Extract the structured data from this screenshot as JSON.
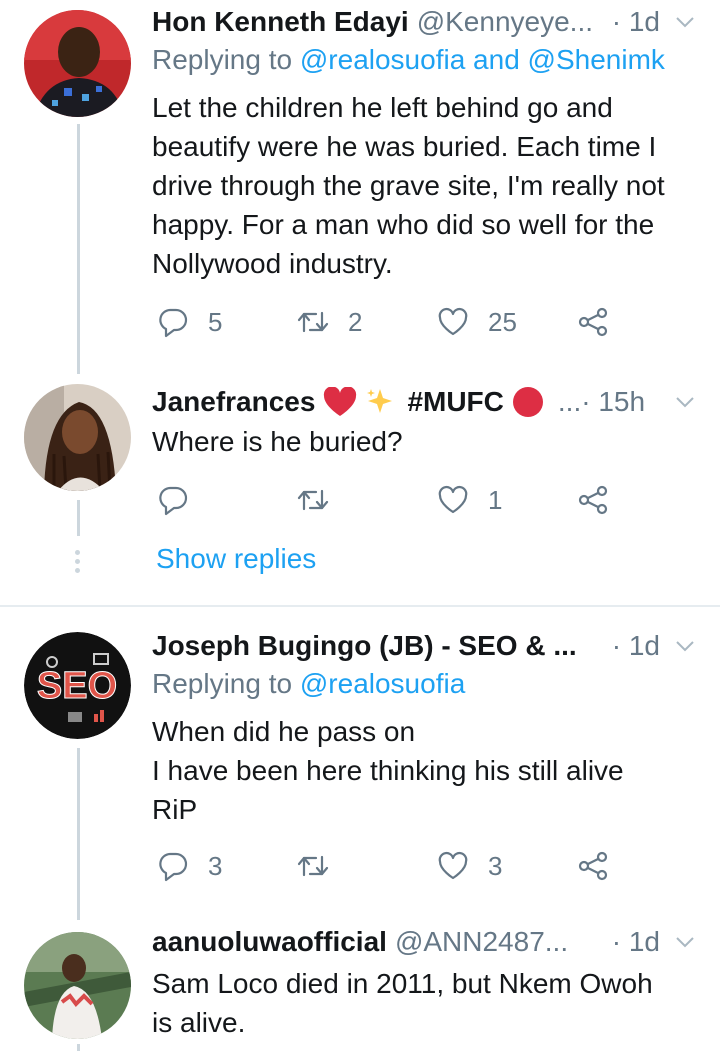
{
  "tweets": [
    {
      "name": "Hon Kenneth Edayi",
      "handle": "@Kennyeye...",
      "time": "· 1d",
      "replying_prefix": "Replying to",
      "replying_mentions": "@realosuofia and @Shenimk",
      "text_lines": [
        "Let the children he left behind go and",
        "beautify were he was buried. Each time I",
        "drive through the grave site, I'm really not",
        "happy. For a man who did so well for the",
        "Nollywood industry."
      ],
      "replies": "5",
      "retweets": "2",
      "likes": "25"
    },
    {
      "name": "Janefrances",
      "name_suffix": "#MUFC",
      "handle": "...",
      "time": "· 15h",
      "text_lines": [
        "Where is he buried?"
      ],
      "replies": "",
      "retweets": "",
      "likes": "1"
    },
    {
      "name": "Joseph Bugingo (JB) - SEO & ...",
      "handle": "",
      "time": "· 1d",
      "replying_prefix": "Replying to",
      "replying_mentions": "@realosuofia",
      "text_lines": [
        "When did he pass on",
        "I have been here thinking his still alive",
        "RiP"
      ],
      "replies": "3",
      "retweets": "",
      "likes": "3"
    },
    {
      "name": "aanuoluwaofficial",
      "handle": "@ANN2487...",
      "time": "· 1d",
      "text_lines": [
        "Sam Loco died in 2011, but Nkem Owoh",
        "is alive."
      ]
    }
  ],
  "show_replies_label": "Show replies",
  "avatar_seo_text": "SEO",
  "colors": {
    "link": "#1da1f2",
    "secondary": "#657786",
    "thread_line": "#ccd6dd",
    "divider": "#e6ecf0"
  },
  "icons": [
    "reply-icon",
    "retweet-icon",
    "like-icon",
    "share-icon",
    "chevron-down-icon",
    "heart-emoji",
    "sparkles-emoji",
    "red-circle-emoji"
  ]
}
